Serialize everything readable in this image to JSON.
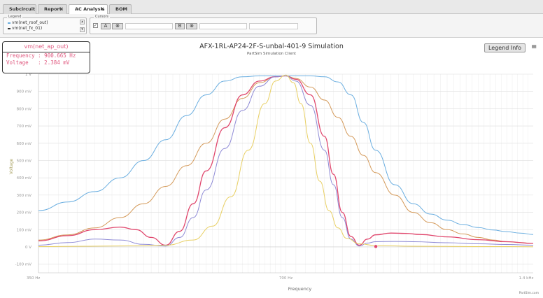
{
  "tabs": [
    {
      "label": "Subcircuit",
      "closable": false,
      "active": false
    },
    {
      "label": "Report",
      "closable": true,
      "active": false
    },
    {
      "label": "AC Analysis",
      "closable": true,
      "active": true
    },
    {
      "label": "BOM",
      "closable": false,
      "active": false
    }
  ],
  "toolbar": {
    "legend_title": "Legend",
    "legend_items": [
      {
        "label": "vm(net_roof_out)",
        "color": "#6aaee0"
      },
      {
        "label": "vm(net_fx_01)",
        "color": "#333333"
      }
    ],
    "cursors_title": "Cursors",
    "cursor_a_label": "A",
    "cursor_b_label": "B",
    "cursor_clear_symbol": "⊗",
    "checkbox_symbol": "✓"
  },
  "chart_header": {
    "title": "AFX-1RL-AP24-2F-S-unbal-401-9 Simulation",
    "subtitle": "PartSim Simulation Client",
    "legend_info_label": "Legend Info",
    "menu_symbol": "≡"
  },
  "tooltip": {
    "series": "vm(net_ap_out)",
    "frequency_line": "Frequency : 900.665 Hz",
    "voltage_line": "Voltage   : 2.384 mV"
  },
  "brand": "PartSim.com",
  "chart_data": {
    "type": "line",
    "xlabel": "Frequency",
    "ylabel": "Voltage",
    "x_ticks": [
      "350 Hz",
      "700 Hz",
      "1.4 kHz"
    ],
    "x_tick_values": [
      350,
      700,
      1400
    ],
    "xscale": "log",
    "xlim": [
      350,
      1400
    ],
    "y_ticks": [
      "-100 mV",
      "0 V",
      "100 mV",
      "200 mV",
      "300 mV",
      "400 mV",
      "500 mV",
      "600 mV",
      "700 mV",
      "800 mV",
      "900 mV",
      "1 V"
    ],
    "y_tick_values": [
      -100,
      0,
      100,
      200,
      300,
      400,
      500,
      600,
      700,
      800,
      900,
      1000
    ],
    "ylim": [
      -150,
      1000
    ],
    "grid": true,
    "series": [
      {
        "color": "#6aaee0",
        "x": [
          350,
          380,
          410,
          440,
          470,
          500,
          530,
          560,
          590,
          620,
          650,
          680,
          700,
          720,
          750,
          780,
          810,
          840,
          870,
          900,
          950,
          1000,
          1050,
          1100,
          1150,
          1200,
          1250,
          1300,
          1350,
          1400
        ],
        "y": [
          210,
          260,
          320,
          400,
          500,
          620,
          760,
          880,
          960,
          985,
          990,
          990,
          990,
          990,
          990,
          985,
          955,
          880,
          720,
          560,
          360,
          250,
          190,
          155,
          130,
          112,
          98,
          88,
          80,
          72
        ]
      },
      {
        "color": "#d49a5a",
        "x": [
          350,
          380,
          410,
          440,
          470,
          500,
          530,
          560,
          590,
          620,
          650,
          680,
          700,
          720,
          750,
          780,
          810,
          840,
          870,
          900,
          950,
          1000,
          1050,
          1100,
          1150,
          1200,
          1250,
          1300,
          1350,
          1400
        ],
        "y": [
          40,
          70,
          110,
          170,
          250,
          350,
          470,
          600,
          740,
          860,
          950,
          985,
          990,
          975,
          925,
          850,
          750,
          640,
          530,
          430,
          300,
          200,
          140,
          100,
          75,
          55,
          40,
          30,
          25,
          20
        ]
      },
      {
        "color": "#e0476d",
        "x": [
          350,
          380,
          410,
          440,
          460,
          480,
          500,
          520,
          540,
          560,
          590,
          620,
          650,
          680,
          700,
          720,
          750,
          780,
          800,
          820,
          840,
          860,
          880,
          900,
          940,
          980,
          1020,
          1100,
          1200,
          1300,
          1400
        ],
        "y": [
          35,
          65,
          100,
          115,
          100,
          55,
          10,
          90,
          250,
          440,
          690,
          880,
          960,
          985,
          990,
          970,
          880,
          640,
          420,
          200,
          60,
          10,
          45,
          70,
          80,
          78,
          72,
          58,
          42,
          30,
          20
        ]
      },
      {
        "color": "#8f8bd6",
        "x": [
          350,
          380,
          410,
          440,
          470,
          500,
          520,
          540,
          560,
          590,
          620,
          650,
          680,
          700,
          720,
          750,
          780,
          800,
          820,
          840,
          860,
          880,
          900,
          950,
          1000,
          1100,
          1200,
          1300,
          1400
        ],
        "y": [
          10,
          25,
          45,
          40,
          15,
          5,
          55,
          170,
          330,
          570,
          790,
          930,
          985,
          990,
          960,
          820,
          560,
          360,
          170,
          45,
          5,
          22,
          30,
          32,
          30,
          24,
          18,
          14,
          10
        ]
      },
      {
        "color": "#e8cf62",
        "x": [
          350,
          400,
          450,
          500,
          540,
          570,
          600,
          630,
          660,
          680,
          700,
          715,
          730,
          750,
          770,
          790,
          810,
          830,
          860,
          900,
          1000,
          1100,
          1200,
          1300,
          1400
        ],
        "y": [
          2,
          4,
          6,
          10,
          40,
          120,
          290,
          560,
          830,
          960,
          995,
          950,
          830,
          600,
          380,
          210,
          110,
          50,
          18,
          8,
          4,
          3,
          2,
          2,
          1
        ]
      }
    ]
  }
}
